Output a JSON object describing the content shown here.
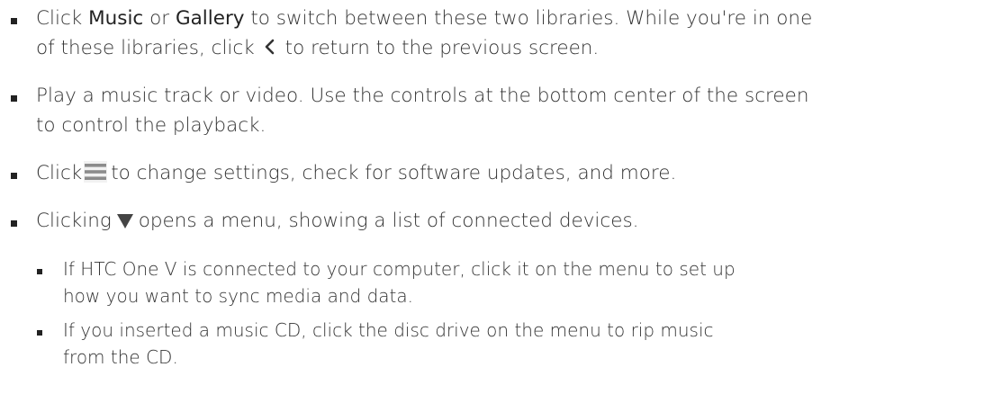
{
  "items": [
    {
      "line1_a": "Click ",
      "line1_music": "Music",
      "line1_or": " or ",
      "line1_gallery": "Gallery",
      "line1_b": " to switch between these two libraries. While you're in one",
      "line2_a": "of these libraries, click",
      "back_icon": "chevron-left-icon",
      "line2_b": "to return to the previous screen."
    },
    {
      "line1": "Play a music track or video. Use the controls at the bottom center of the screen",
      "line2": "to control the playback."
    },
    {
      "line1_a": "Click",
      "menu_icon": "hamburger-menu-icon",
      "line1_b": "to change settings, check for software updates, and more."
    },
    {
      "line1_a": "Clicking",
      "dropdown_icon": "triangle-down-icon",
      "line1_b": "opens a menu, showing a list of connected devices."
    }
  ],
  "subitems": [
    {
      "line1": "If HTC One V is connected to your computer, click it on the menu to set up",
      "line2": "how you want to sync media and data."
    },
    {
      "line1": "If you inserted a music CD, click the disc drive on the menu to rip music",
      "line2": "from the CD."
    }
  ],
  "colors": {
    "text": "#333333",
    "bullet": "#222222",
    "icon_gray": "#8c8c8c",
    "icon_dark": "#444444"
  }
}
